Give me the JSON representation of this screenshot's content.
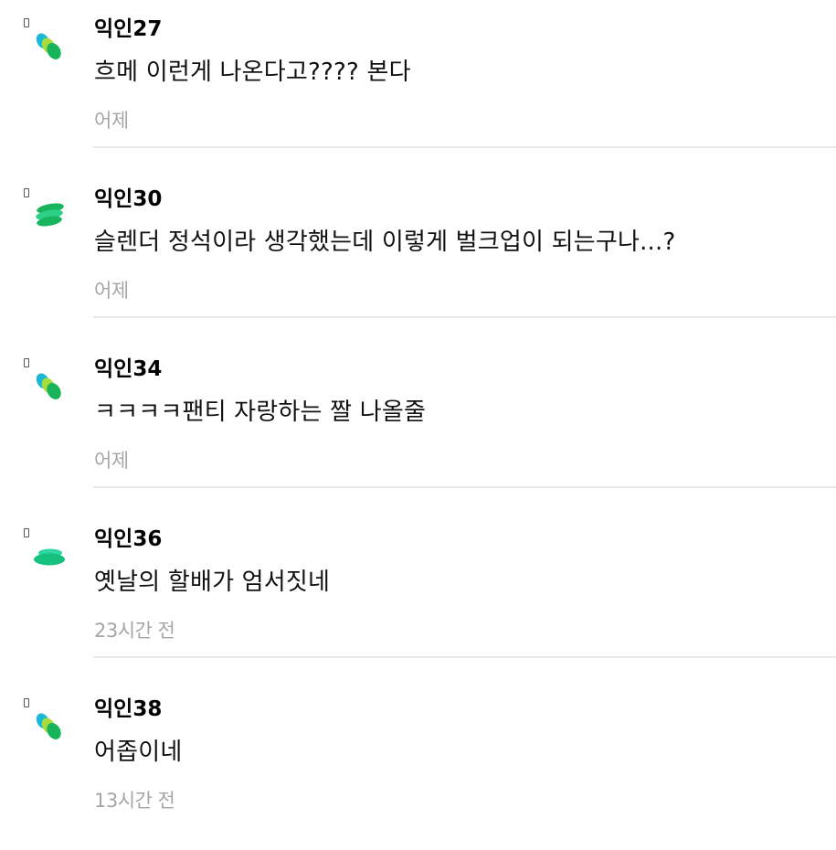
{
  "comments": [
    {
      "author": "익인27",
      "text": "흐메 이런게 나온다고???? 본다",
      "time": "어제",
      "avatar_icon": "tri-dot-icon",
      "colors": {
        "teal": "#1ab8d6",
        "lime": "#a6dc3c",
        "green": "#17b45a"
      }
    },
    {
      "author": "익인30",
      "text": "슬렌더 정석이라 생각했는데 이렇게 벌크업이 되는구나...?",
      "time": "어제",
      "avatar_icon": "stacked-leaf-icon",
      "colors": {
        "green": "#19b55e",
        "mint": "#2ccf87"
      }
    },
    {
      "author": "익인34",
      "text": "ㅋㅋㅋㅋ팬티 자랑하는 짤 나올줄",
      "time": "어제",
      "avatar_icon": "tri-dot-icon",
      "colors": {
        "teal": "#1ab8d6",
        "lime": "#a6dc3c",
        "green": "#17b45a"
      }
    },
    {
      "author": "익인36",
      "text": "옛날의 할배가 엄서짓네",
      "time": "23시간 전",
      "avatar_icon": "disc-icon",
      "colors": {
        "mint": "#2fd6a0",
        "green": "#16c07e"
      }
    },
    {
      "author": "익인38",
      "text": "어좁이네",
      "time": "13시간 전",
      "avatar_icon": "tri-dot-icon",
      "colors": {
        "teal": "#1ab8d6",
        "lime": "#a6dc3c",
        "green": "#17b45a"
      }
    }
  ]
}
